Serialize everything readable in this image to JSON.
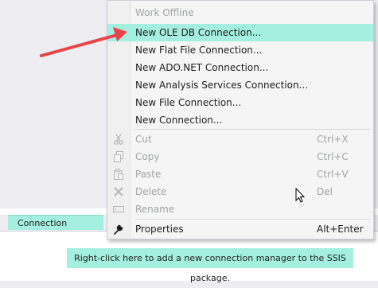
{
  "menu": {
    "work_offline": "Work Offline",
    "new_oledb": "New OLE DB Connection...",
    "new_flat_file": "New Flat File Connection...",
    "new_adonet": "New ADO.NET Connection...",
    "new_analysis": "New Analysis Services Connection...",
    "new_file": "New File Connection...",
    "new_connection": "New Connection...",
    "cut": "Cut",
    "cut_shortcut": "Ctrl+X",
    "copy": "Copy",
    "copy_shortcut": "Ctrl+C",
    "paste": "Paste",
    "paste_shortcut": "Ctrl+V",
    "delete": "Delete",
    "delete_shortcut": "Del",
    "rename": "Rename",
    "properties": "Properties",
    "properties_shortcut": "Alt+Enter"
  },
  "panel": {
    "tab_label": "Connection Managers",
    "hint": "Right-click here to add a new connection manager to the SSIS package."
  },
  "colors": {
    "highlight": "#a4efe0",
    "arrow": "#e8454a",
    "disabled_text": "#a2a4a5"
  }
}
